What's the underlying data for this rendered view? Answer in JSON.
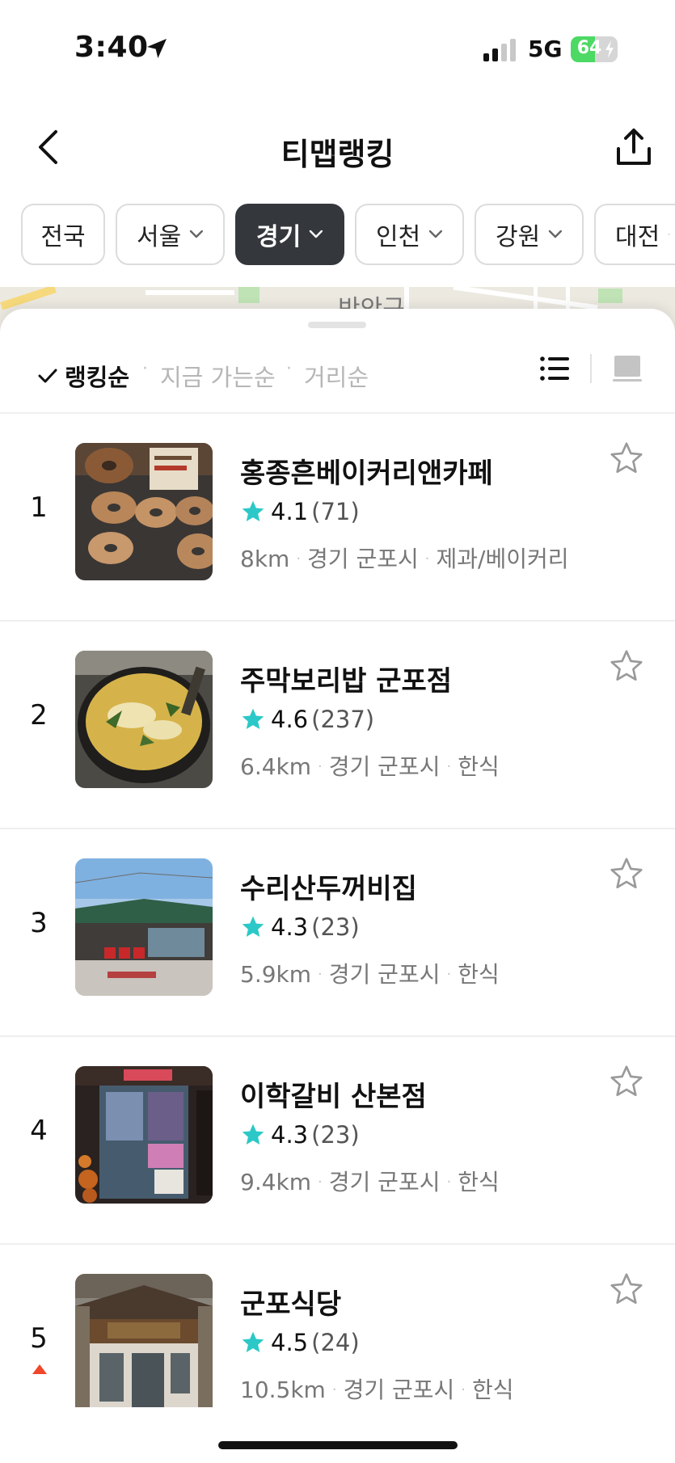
{
  "status_bar": {
    "time": "3:40",
    "network": "5G",
    "battery": "64",
    "battery_level": 64,
    "location_icon": "location-arrow-icon",
    "signal_icon": "signal-bars-icon"
  },
  "header": {
    "title": "티맵랭킹",
    "back_icon": "chevron-left-icon",
    "share_icon": "share-icon"
  },
  "regions": [
    {
      "label": "전국",
      "active": false,
      "has_dropdown": false
    },
    {
      "label": "서울",
      "active": false,
      "has_dropdown": true
    },
    {
      "label": "경기",
      "active": true,
      "has_dropdown": true
    },
    {
      "label": "인천",
      "active": false,
      "has_dropdown": true
    },
    {
      "label": "강원",
      "active": false,
      "has_dropdown": true
    },
    {
      "label": "대전",
      "active": false,
      "has_dropdown": true
    }
  ],
  "map": {
    "label": "반안구"
  },
  "sort": {
    "active": "랭킹순",
    "options": [
      "지금 가는순",
      "거리순"
    ],
    "separator": "·",
    "list_view_icon": "list-view-icon",
    "card_view_icon": "card-view-icon"
  },
  "colors": {
    "accent_star": "#2cc8c8",
    "active_chip": "#34383d",
    "rank_up": "#f0462a"
  },
  "places": [
    {
      "rank": "1",
      "name": "홍종흔베이커리앤카페",
      "rating": "4.1",
      "reviews": "(71)",
      "distance": "8km",
      "region": "경기 군포시",
      "category": "제과/베이커리",
      "rank_up": false
    },
    {
      "rank": "2",
      "name": "주막보리밥 군포점",
      "rating": "4.6",
      "reviews": "(237)",
      "distance": "6.4km",
      "region": "경기 군포시",
      "category": "한식",
      "rank_up": false
    },
    {
      "rank": "3",
      "name": "수리산두꺼비집",
      "rating": "4.3",
      "reviews": "(23)",
      "distance": "5.9km",
      "region": "경기 군포시",
      "category": "한식",
      "rank_up": false
    },
    {
      "rank": "4",
      "name": "이학갈비 산본점",
      "rating": "4.3",
      "reviews": "(23)",
      "distance": "9.4km",
      "region": "경기 군포시",
      "category": "한식",
      "rank_up": false
    },
    {
      "rank": "5",
      "name": "군포식당",
      "rating": "4.5",
      "reviews": "(24)",
      "distance": "10.5km",
      "region": "경기 군포시",
      "category": "한식",
      "rank_up": true
    }
  ]
}
